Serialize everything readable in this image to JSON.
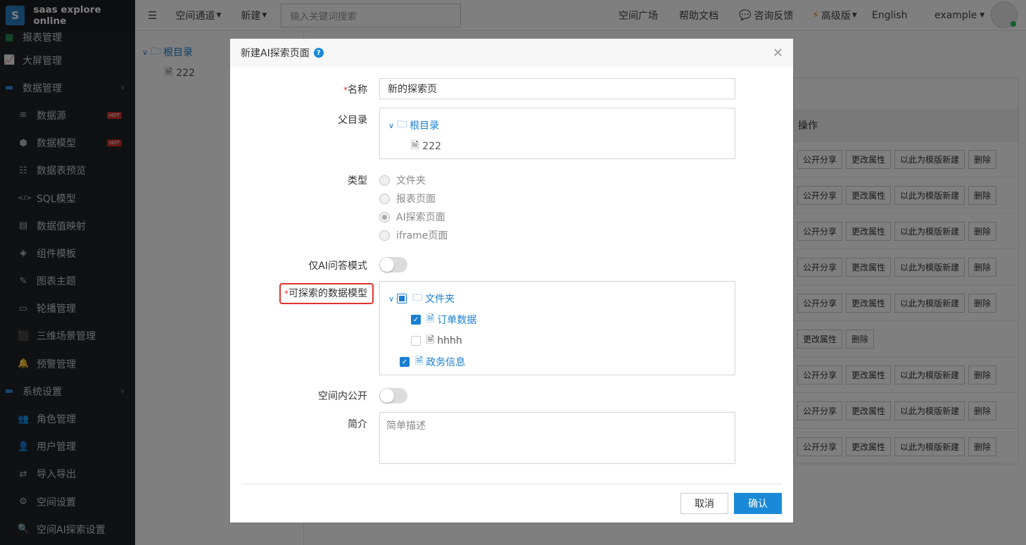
{
  "app": {
    "logo_letter": "S",
    "name": "saas explore online"
  },
  "sidebar": {
    "first": "报表管理",
    "items": [
      {
        "label": "大屏管理",
        "icon": "chart-line-icon",
        "top": true
      },
      {
        "label": "数据管理",
        "icon": "folder-icon",
        "top": true,
        "caret": true
      },
      {
        "label": "数据源",
        "icon": "database-icon",
        "hot": "HOT"
      },
      {
        "label": "数据模型",
        "icon": "cubes-icon",
        "hot": "HOT"
      },
      {
        "label": "数据表预览",
        "icon": "list-icon"
      },
      {
        "label": "SQL模型",
        "icon": "code-icon"
      },
      {
        "label": "数据值映射",
        "icon": "book-icon"
      },
      {
        "label": "组件模板",
        "icon": "cube-outline-icon"
      },
      {
        "label": "图表主题",
        "icon": "brush-icon"
      },
      {
        "label": "轮播管理",
        "icon": "monitor-icon"
      },
      {
        "label": "三维场景管理",
        "icon": "box-icon"
      },
      {
        "label": "预警管理",
        "icon": "bell-icon"
      },
      {
        "label": "系统设置",
        "icon": "folder-icon",
        "top": true,
        "caret": true
      },
      {
        "label": "角色管理",
        "icon": "users-icon"
      },
      {
        "label": "用户管理",
        "icon": "user-icon"
      },
      {
        "label": "导入导出",
        "icon": "exchange-icon"
      },
      {
        "label": "空间设置",
        "icon": "gear-icon"
      },
      {
        "label": "空间AI探索设置",
        "icon": "search-icon"
      }
    ]
  },
  "topbar": {
    "space_channel": "空间通道",
    "new": "新建",
    "search_placeholder": "输入关键词搜索",
    "space_square": "空间广场",
    "help_docs": "帮助文档",
    "feedback": "咨询反馈",
    "advanced": "高级版",
    "language": "English",
    "user": "example"
  },
  "bg_tree": {
    "root": "根目录",
    "child": "222"
  },
  "bg_table": {
    "header": "操作",
    "rows": [
      [
        "公开分享",
        "更改属性",
        "以此为模版新建",
        "删除"
      ],
      [
        "公开分享",
        "更改属性",
        "以此为模版新建",
        "删除"
      ],
      [
        "公开分享",
        "更改属性",
        "以此为模版新建",
        "删除"
      ],
      [
        "公开分享",
        "更改属性",
        "以此为模版新建",
        "删除"
      ],
      [
        "公开分享",
        "更改属性",
        "以此为模版新建",
        "删除"
      ],
      [
        "更改属性",
        "删除"
      ],
      [
        "公开分享",
        "更改属性",
        "以此为模版新建",
        "删除"
      ],
      [
        "公开分享",
        "更改属性",
        "以此为模版新建",
        "删除"
      ],
      [
        "公开分享",
        "更改属性",
        "以此为模版新建",
        "删除"
      ]
    ]
  },
  "modal": {
    "title": "新建AI探索页面",
    "required_mark": "*",
    "name_label": "名称",
    "name_value": "新的探索页",
    "parent_label": "父目录",
    "parent_root": "根目录",
    "parent_child": "222",
    "type_label": "类型",
    "type_options": [
      "文件夹",
      "报表页面",
      "AI探索页面",
      "iframe页面"
    ],
    "type_selected": "AI探索页面",
    "ai_only_label": "仅AI问答模式",
    "models_label": "可探索的数据模型",
    "models_folder": "文件夹",
    "models_item1": "订单数据",
    "models_item2": "hhhh",
    "models_item3": "政务信息",
    "public_label": "空间内公开",
    "desc_label": "简介",
    "desc_placeholder": "简单描述",
    "cancel": "取消",
    "confirm": "确认"
  },
  "colors": {
    "accent": "#1a7fd0",
    "sidebar_bg": "#1f2227",
    "highlight": "#e0322e"
  }
}
